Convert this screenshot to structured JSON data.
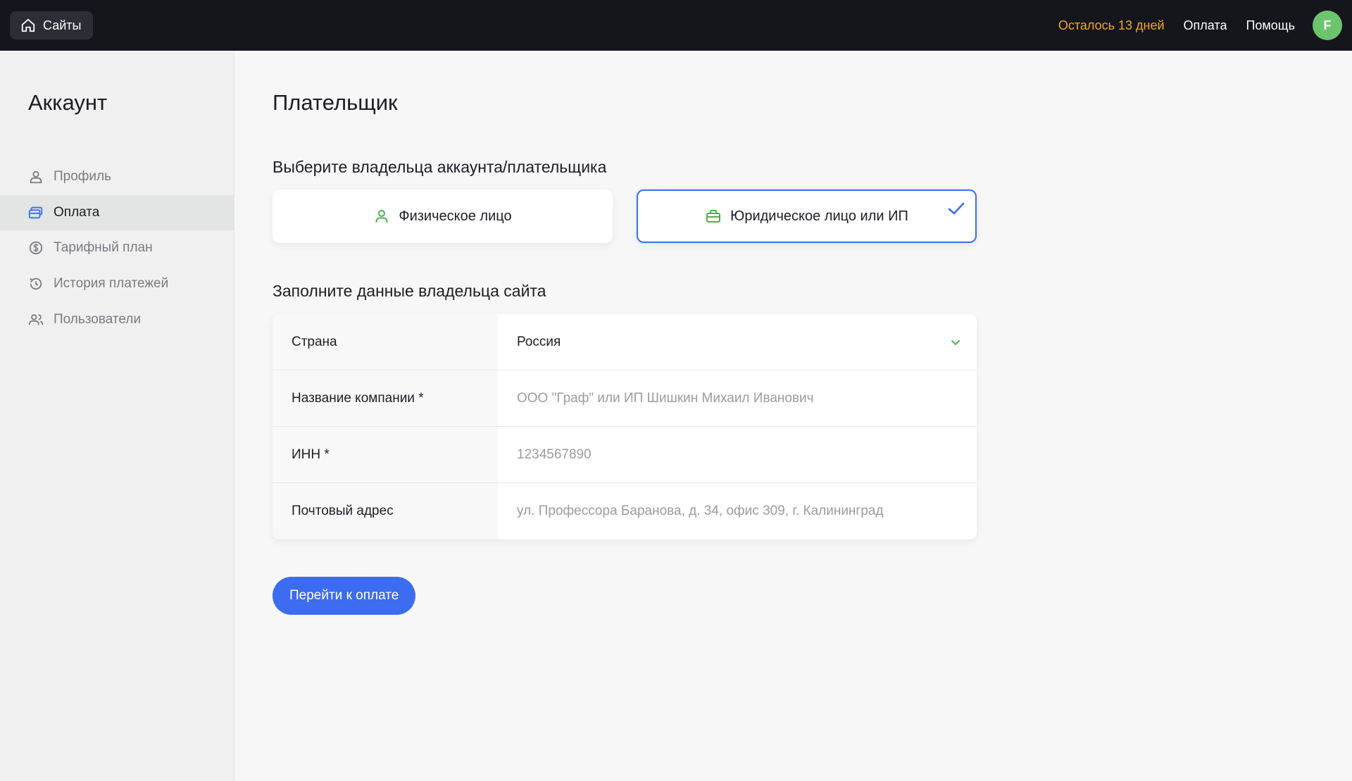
{
  "topbar": {
    "home_label": "Сайты",
    "trial": "Осталось 13 дней",
    "payment_link": "Оплата",
    "help_link": "Помощь",
    "avatar_letter": "F"
  },
  "sidebar": {
    "title": "Аккаунт",
    "items": [
      {
        "label": "Профиль",
        "icon": "user-icon"
      },
      {
        "label": "Оплата",
        "icon": "card-icon",
        "active": true
      },
      {
        "label": "Тарифный план",
        "icon": "dollar-icon"
      },
      {
        "label": "История платежей",
        "icon": "history-icon"
      },
      {
        "label": "Пользователи",
        "icon": "users-icon"
      }
    ]
  },
  "main": {
    "title": "Плательщик",
    "owner_section": "Выберите владельца аккаунта/плательщика",
    "choices": [
      {
        "label": "Физическое лицо",
        "icon": "person-icon",
        "selected": false
      },
      {
        "label": "Юридическое лицо или ИП",
        "icon": "briefcase-icon",
        "selected": true
      }
    ],
    "form_section": "Заполните данные владельца сайта",
    "form": [
      {
        "label": "Страна",
        "value": "Россия",
        "kind": "select"
      },
      {
        "label": "Название компании *",
        "placeholder": "ООО \"Граф\" или ИП Шишкин Михаил Иванович"
      },
      {
        "label": "ИНН *",
        "placeholder": "1234567890"
      },
      {
        "label": "Почтовый адрес",
        "placeholder": "ул. Профессора Баранова, д. 34, офис 309, г. Калининград"
      }
    ],
    "submit_label": "Перейти к оплате"
  },
  "colors": {
    "accent": "#3c6df0",
    "trial": "#f5a623",
    "green": "#4caf50",
    "topbar": "#15161c"
  }
}
